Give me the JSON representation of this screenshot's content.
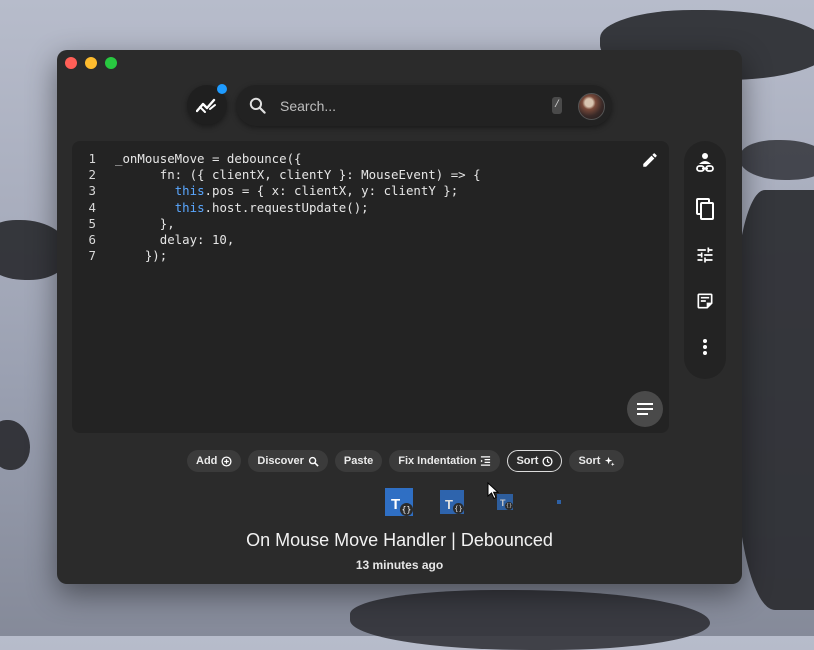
{
  "window": {
    "buttons": [
      "close",
      "minimize",
      "zoom"
    ]
  },
  "search": {
    "placeholder": "Search...",
    "shortcut": "/"
  },
  "editor": {
    "lines": [
      {
        "n": "1",
        "parts": [
          {
            "t": "_onMouseMove = debounce({"
          }
        ]
      },
      {
        "n": "2",
        "parts": [
          {
            "t": "      fn: ({ clientX, clientY }: MouseEvent) => {"
          }
        ]
      },
      {
        "n": "3",
        "parts": [
          {
            "t": "        "
          },
          {
            "t": "this",
            "kw": true
          },
          {
            "t": ".pos = { x: clientX, y: clientY };"
          }
        ]
      },
      {
        "n": "4",
        "parts": [
          {
            "t": "        "
          },
          {
            "t": "this",
            "kw": true
          },
          {
            "t": ".host.requestUpdate();"
          }
        ]
      },
      {
        "n": "5",
        "parts": [
          {
            "t": "      },"
          }
        ]
      },
      {
        "n": "6",
        "parts": [
          {
            "t": "      delay: 10,"
          }
        ]
      },
      {
        "n": "7",
        "parts": [
          {
            "t": "    });"
          }
        ]
      }
    ]
  },
  "side_toolbar": [
    {
      "name": "share-link-icon"
    },
    {
      "name": "copy-icon"
    },
    {
      "name": "tune-icon"
    },
    {
      "name": "note-icon"
    },
    {
      "name": "more-vert-icon"
    }
  ],
  "actions": [
    {
      "label": "Add",
      "icon": "add-circle-icon"
    },
    {
      "label": "Discover",
      "icon": "search-zoom-icon"
    },
    {
      "label": "Paste",
      "icon": ""
    },
    {
      "label": "Fix Indentation",
      "icon": "indent-icon"
    },
    {
      "label": "Sort",
      "icon": "clock-icon",
      "active": true
    },
    {
      "label": "Sort",
      "icon": "sparkle-icon"
    }
  ],
  "snippet": {
    "title": "On Mouse Move Handler | Debounced",
    "time": "13 minutes ago"
  },
  "colors": {
    "accent": "#1e9bff",
    "keyword": "#5aa7ff",
    "window_bg": "#2b2b2b",
    "editor_bg": "#232323",
    "ts_blue": "#2f6fc4"
  }
}
